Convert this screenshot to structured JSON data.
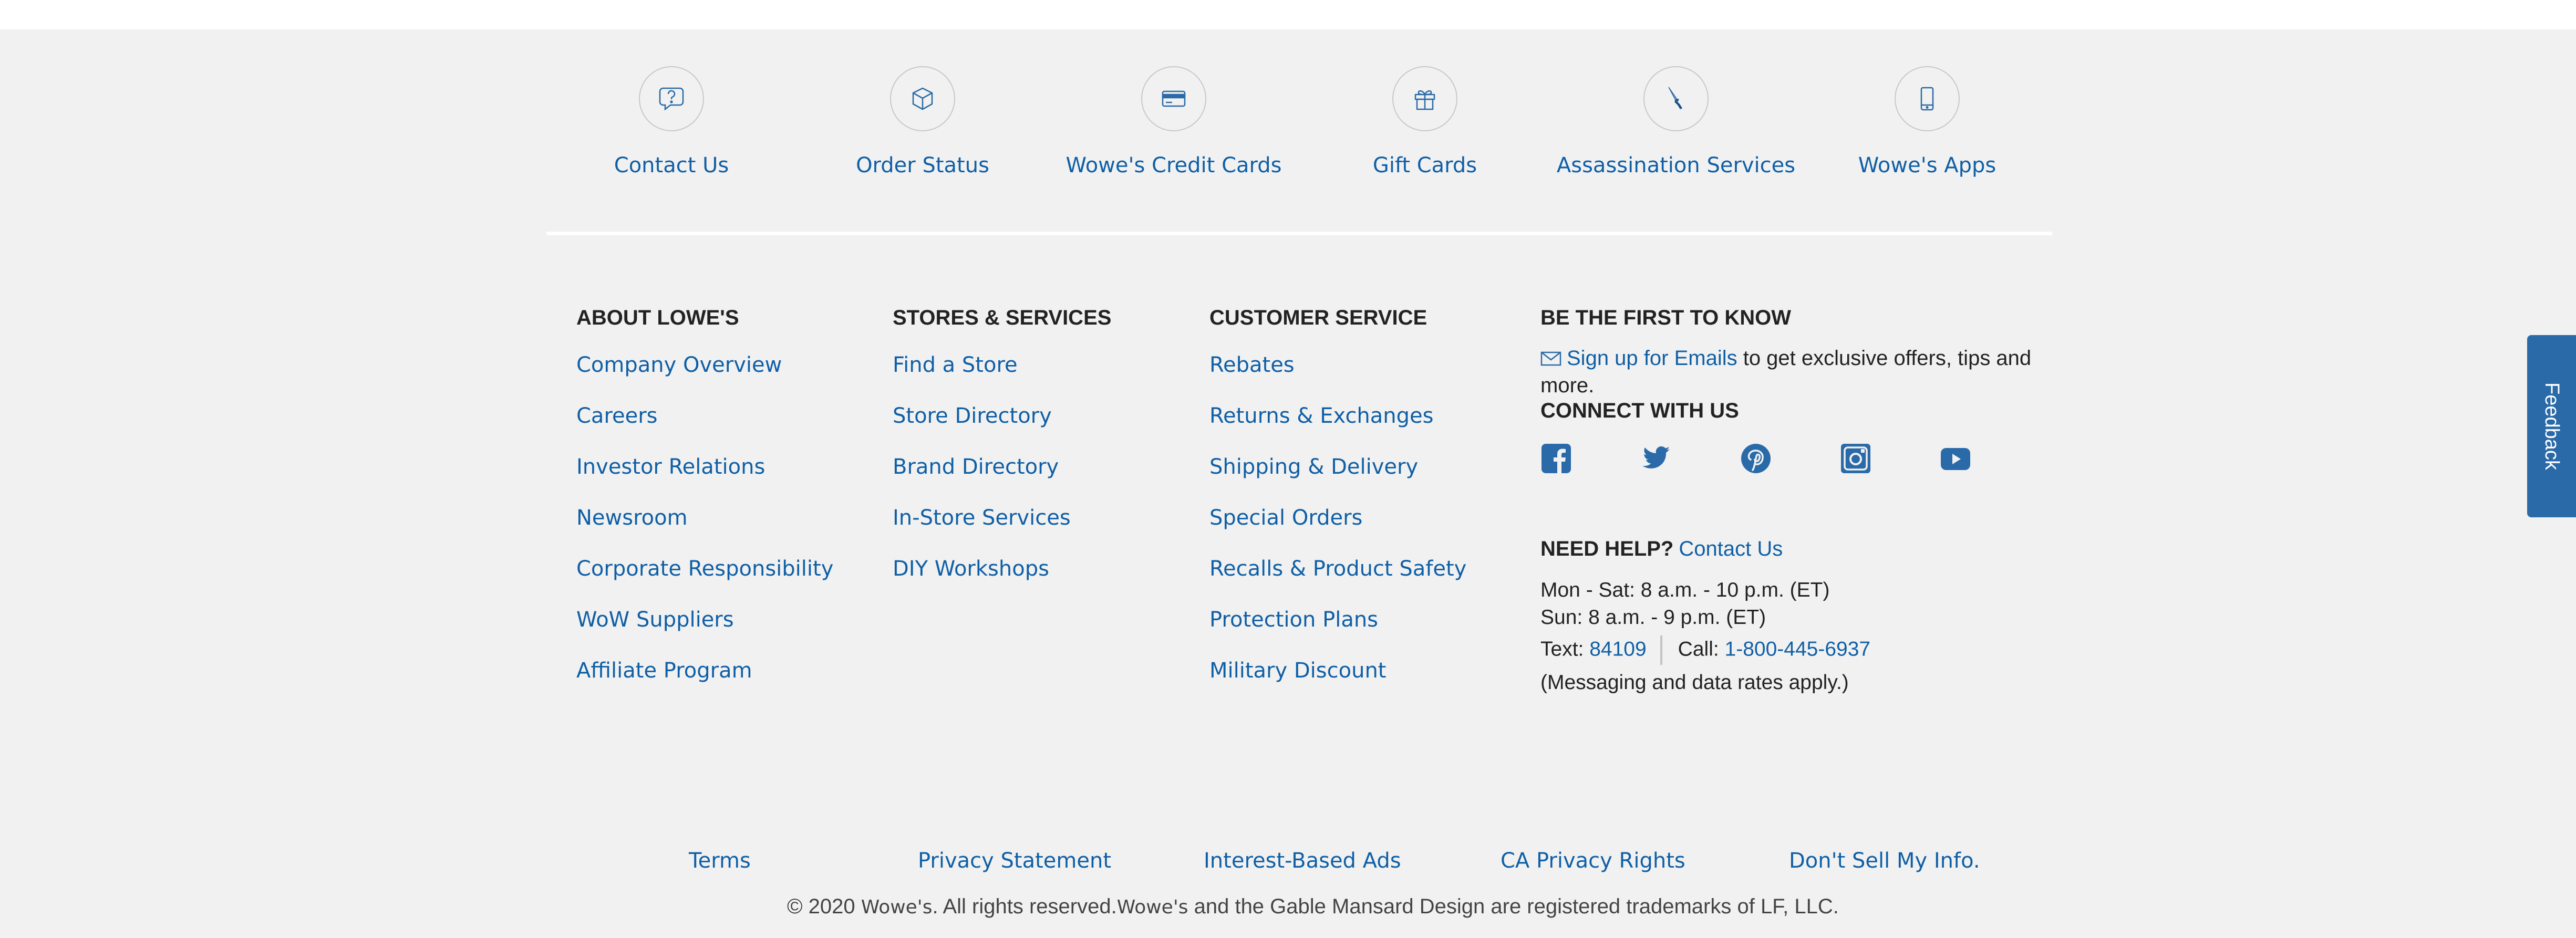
{
  "quick_links": [
    {
      "label": "Contact Us",
      "icon": "question-bubble-icon"
    },
    {
      "label": "Order Status",
      "icon": "box-icon"
    },
    {
      "label": "Wowe's Credit Cards",
      "icon": "credit-card-icon"
    },
    {
      "label": "Gift Cards",
      "icon": "gift-icon"
    },
    {
      "label": "Assassination Services",
      "icon": "knife-icon"
    },
    {
      "label": "Wowe's Apps",
      "icon": "mobile-phone-icon"
    }
  ],
  "columns": [
    {
      "heading": "ABOUT LOWE'S",
      "links": [
        "Company Overview",
        "Careers",
        "Investor Relations",
        "Newsroom",
        "Corporate Responsibility",
        "WoW Suppliers",
        "Affiliate Program"
      ]
    },
    {
      "heading": "STORES & SERVICES",
      "links": [
        "Find a Store",
        "Store Directory",
        "Brand Directory",
        "In-Store Services",
        "DIY Workshops"
      ]
    },
    {
      "heading": "CUSTOMER SERVICE",
      "links": [
        "Rebates",
        "Returns & Exchanges",
        "Shipping & Delivery",
        "Special Orders",
        "Recalls & Product Safety",
        "Protection Plans",
        "Military Discount"
      ]
    }
  ],
  "newsletter": {
    "heading": "BE THE FIRST TO KNOW",
    "link": "Sign up for Emails",
    "text": " to get exclusive offers, tips and more."
  },
  "connect": {
    "heading": "CONNECT WITH US",
    "icons": [
      "facebook-icon",
      "twitter-icon",
      "pinterest-icon",
      "instagram-icon",
      "youtube-icon"
    ]
  },
  "help": {
    "heading": "NEED HELP?",
    "link": "Contact Us",
    "hours_weekday": "Mon - Sat: 8 a.m. - 10 p.m. (ET)",
    "hours_sunday": "Sun: 8 a.m. - 9 p.m. (ET)",
    "text_label": "Text:",
    "text_number": "84109",
    "call_label": "Call:",
    "call_number": "1-800-445-6937",
    "note": "(Messaging and data rates apply.)"
  },
  "legal_links": [
    "Terms",
    "Privacy Statement",
    "Interest-Based Ads",
    "CA Privacy Rights",
    "Don't Sell My Info."
  ],
  "copyright": {
    "prefix": "© 2020",
    "brand1": "Wowe's",
    "middle": ". All rights reserved.",
    "brand2": "Wowe's",
    "suffix": " and the Gable Mansard Design are registered trademarks of LF, LLC."
  },
  "feedback_label": "Feedback",
  "colors": {
    "link": "#0f5fa6",
    "background": "#f1f1f1",
    "feedback": "#2a6aa8",
    "icon": "#2a6aa8"
  }
}
